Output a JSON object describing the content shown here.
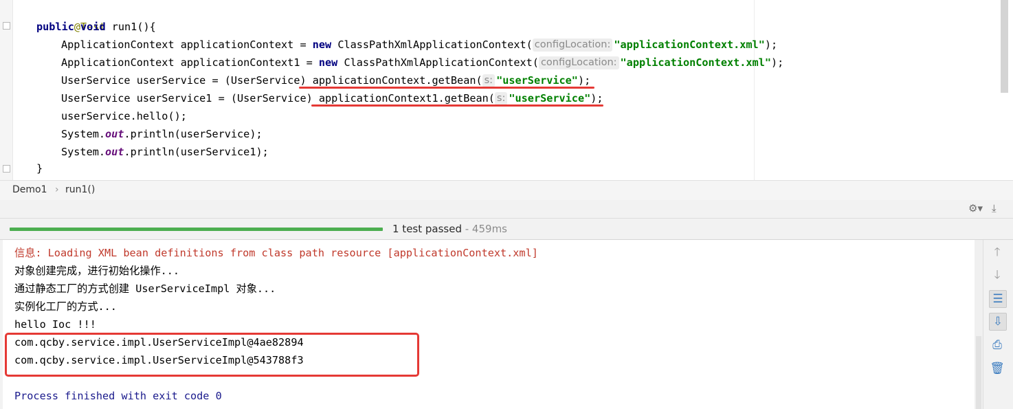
{
  "editor": {
    "lines": {
      "l0": {
        "annotation": "@Test"
      },
      "l1": {
        "kw1": "public",
        "kw2": "void",
        "rest": " run1(){"
      },
      "l2": {
        "pre": "ApplicationContext applicationContext = ",
        "kw": "new",
        "mid": " ClassPathXmlApplicationContext(",
        "hint": "configLocation:",
        "str": "\"applicationContext.xml\"",
        "post": ");"
      },
      "l3": {
        "pre": "ApplicationContext applicationContext1 = ",
        "kw": "new",
        "mid": " ClassPathXmlApplicationContext(",
        "hint": "configLocation:",
        "str": "\"applicationContext.xml\"",
        "post": ");"
      },
      "l4": {
        "pre": "UserService userService = (UserService) applicationContext.getBean(",
        "hint": "s:",
        "str": "\"userService\"",
        "post": ");"
      },
      "l5": {
        "pre": "UserService userService1 = (UserService) applicationContext1.getBean(",
        "hint": "s:",
        "str": "\"userService\"",
        "post": ");"
      },
      "l6": {
        "text": "userService.hello();"
      },
      "l7": {
        "pre": "System.",
        "static": "out",
        "post": ".println(userService);"
      },
      "l8": {
        "pre": "System.",
        "static": "out",
        "post": ".println(userService1);"
      },
      "l9": {
        "text": "}"
      }
    }
  },
  "breadcrumb": {
    "class_name": "Demo1",
    "separator": "›",
    "method": "run1()"
  },
  "toolbar": {
    "settings_icon": "⚙▾",
    "pin_icon": "⤓"
  },
  "status": {
    "text": "1 test passed",
    "time": " - 459ms"
  },
  "console": {
    "info_line": "信息: Loading XML bean definitions from class path resource [applicationContext.xml]",
    "lines": [
      "对象创建完成，进行初始化操作...",
      "通过静态工厂的方式创建 UserServiceImpl 对象...",
      "实例化工厂的方式...",
      "hello Ioc !!!",
      "com.qcby.service.impl.UserServiceImpl@4ae82894",
      "com.qcby.service.impl.UserServiceImpl@543788f3"
    ],
    "exit_line": "Process finished with exit code 0"
  },
  "side_actions": {
    "up": "🡑",
    "down": "🡓",
    "wrap": "☰",
    "scroll_end": "⇩",
    "print": "⎙",
    "trash": "🗑"
  },
  "colors": {
    "progress": "#4cae50",
    "highlight": "#e53935"
  }
}
